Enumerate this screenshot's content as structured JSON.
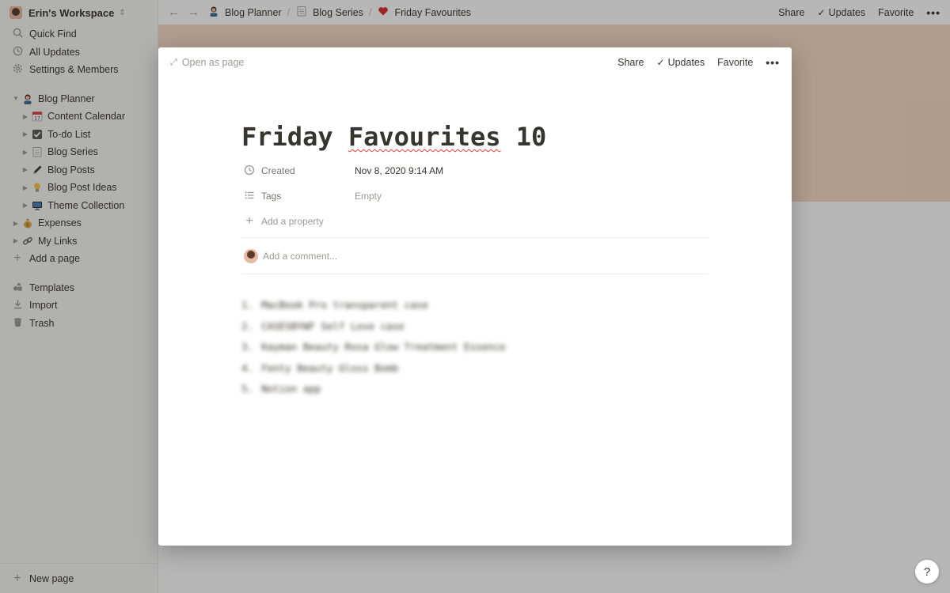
{
  "workspace": {
    "name": "Erin's Workspace"
  },
  "sidebar": {
    "nav": [
      {
        "label": "Quick Find",
        "icon": "search-icon"
      },
      {
        "label": "All Updates",
        "icon": "clock-icon"
      },
      {
        "label": "Settings & Members",
        "icon": "gear-icon"
      }
    ],
    "pages": [
      {
        "label": "Blog Planner",
        "icon": "person-icon",
        "expanded": true
      },
      {
        "label": "Content Calendar",
        "icon": "calendar-icon"
      },
      {
        "label": "To-do List",
        "icon": "checkbox-icon"
      },
      {
        "label": "Blog Series",
        "icon": "notepad-icon"
      },
      {
        "label": "Blog Posts",
        "icon": "pen-icon"
      },
      {
        "label": "Blog Post Ideas",
        "icon": "lightbulb-icon"
      },
      {
        "label": "Theme Collection",
        "icon": "monitor-icon"
      },
      {
        "label": "Expenses",
        "icon": "moneybag-icon"
      },
      {
        "label": "My Links",
        "icon": "link-icon"
      }
    ],
    "add_page": "Add a page",
    "tools": [
      {
        "label": "Templates",
        "icon": "templates-icon"
      },
      {
        "label": "Import",
        "icon": "download-icon"
      },
      {
        "label": "Trash",
        "icon": "trash-icon"
      }
    ],
    "new_page": "New page"
  },
  "topbar": {
    "breadcrumbs": [
      {
        "label": "Blog Planner",
        "icon": "person-icon"
      },
      {
        "label": "Blog Series",
        "icon": "notepad-icon"
      },
      {
        "label": "Friday Favourites",
        "icon": "heart-icon"
      }
    ],
    "share": "Share",
    "updates": "Updates",
    "favorite": "Favorite",
    "more": "•••"
  },
  "modal": {
    "open_as_page": "Open as page",
    "share": "Share",
    "updates": "Updates",
    "favorite": "Favorite",
    "more": "•••",
    "title_word1": "Friday",
    "title_word2": "Favourites",
    "title_word3": "10",
    "properties": [
      {
        "name": "Created",
        "value": "Nov 8, 2020 9:14 AM",
        "icon": "clock-icon"
      },
      {
        "name": "Tags",
        "value": "Empty",
        "icon": "list-icon"
      }
    ],
    "add_property": "Add a property",
    "comment_placeholder": "Add a comment...",
    "items": [
      {
        "num": "1.",
        "text": "MacBook Pro transparent case"
      },
      {
        "num": "2.",
        "text": "CASESBYWF Self Love case"
      },
      {
        "num": "3.",
        "text": "Kayman Beauty Rosa Glow Treatment Essence"
      },
      {
        "num": "4.",
        "text": "Fenty Beauty Gloss Bomb"
      },
      {
        "num": "5.",
        "text": "Notion app"
      }
    ]
  },
  "colors": {
    "banner": "#f6d9c3",
    "sidebar_bg": "#f7f6f3",
    "text": "#37352f",
    "muted": "#9b9a97"
  }
}
